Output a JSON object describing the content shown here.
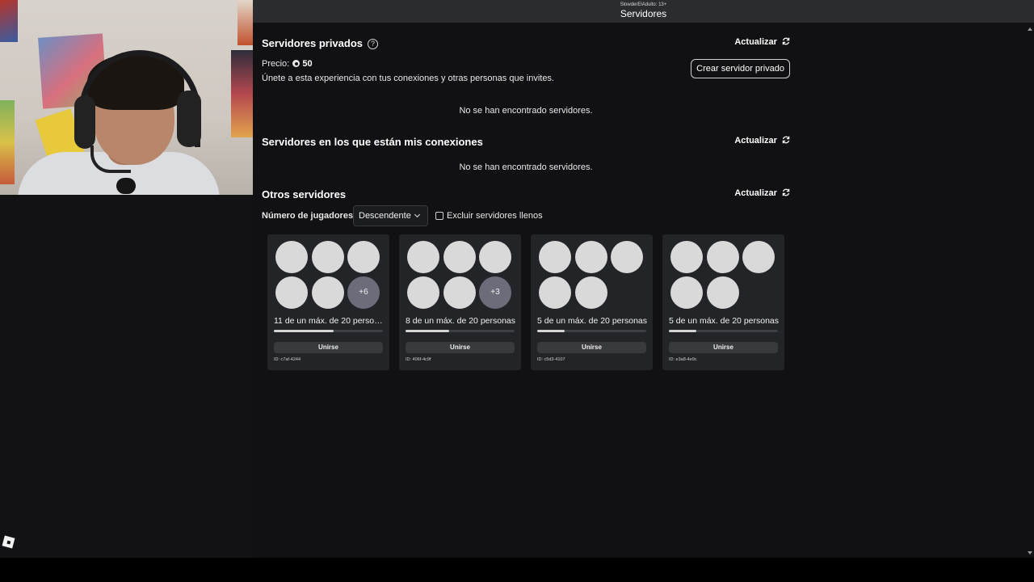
{
  "topbar": {
    "subtitle": "SlowderElAdulto: 13+",
    "title": "Servidores"
  },
  "private_servers": {
    "title": "Servidores privados",
    "refresh_label": "Actualizar",
    "price_label": "Precio:",
    "price_value": "50",
    "description": "Únete a esta experiencia con tus conexiones y otras personas que invites.",
    "create_button": "Crear servidor privado",
    "empty_message": "No se han encontrado servidores."
  },
  "connection_servers": {
    "title": "Servidores en los que están mis conexiones",
    "refresh_label": "Actualizar",
    "empty_message": "No se han encontrado servidores."
  },
  "other_servers": {
    "title": "Otros servidores",
    "refresh_label": "Actualizar",
    "sort_label": "Número de jugadores",
    "sort_selected": "Descendente",
    "exclude_full_label": "Excluir servidores llenos",
    "exclude_full_checked": false,
    "join_label": "Unirse",
    "servers": [
      {
        "players_text": "11 de un máx. de 20 personas",
        "fill_fraction": 0.55,
        "visible_avatars": 5,
        "more_badge": "+6",
        "id_text": "ID: c7af-4244"
      },
      {
        "players_text": "8 de un máx. de 20 personas",
        "fill_fraction": 0.4,
        "visible_avatars": 5,
        "more_badge": "+3",
        "id_text": "ID: 406f-4c9f"
      },
      {
        "players_text": "5 de un máx. de 20 personas",
        "fill_fraction": 0.25,
        "visible_avatars": 5,
        "more_badge": "",
        "id_text": "ID: c5d3-4107"
      },
      {
        "players_text": "5 de un máx. de 20 personas",
        "fill_fraction": 0.25,
        "visible_avatars": 5,
        "more_badge": "",
        "id_text": "ID: e3a8-4e9c"
      }
    ]
  },
  "icons": {
    "help": "question-circle-icon",
    "refresh": "refresh-icon",
    "currency": "robux-icon",
    "dropdown": "chevron-down-icon",
    "app_logo": "roblox-logo-icon"
  },
  "colors": {
    "background": "#111113",
    "card": "#232427",
    "avatar_placeholder": "#d9d9d9",
    "more_badge": "#6b6d7a",
    "join_button": "#393a3e"
  }
}
